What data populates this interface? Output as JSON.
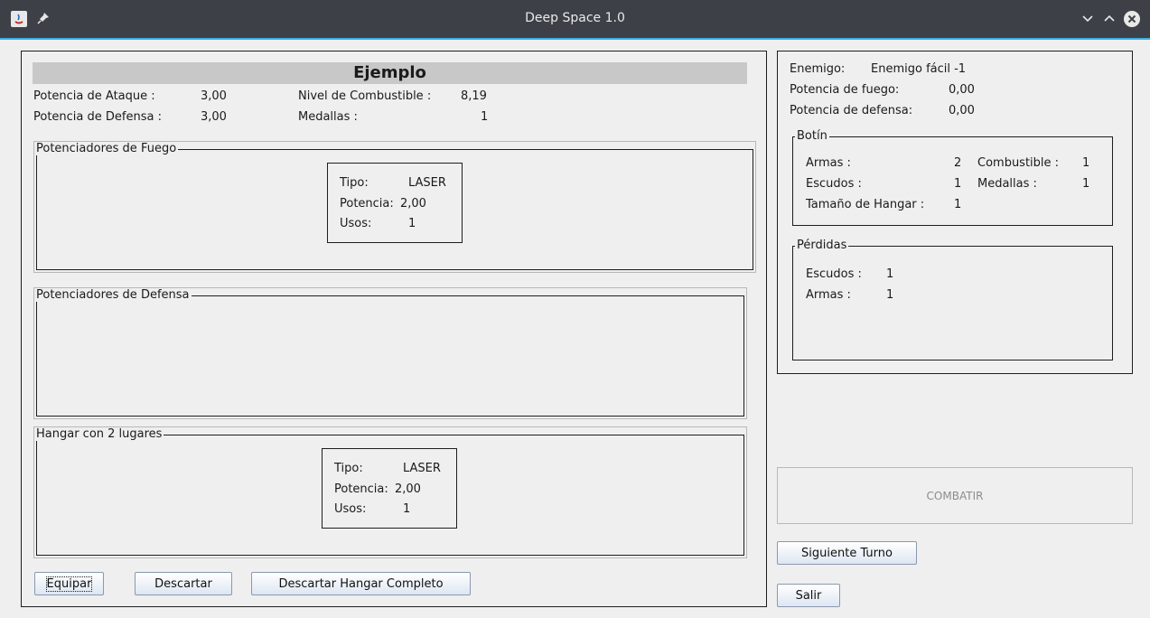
{
  "window": {
    "title": "Deep Space 1.0"
  },
  "station": {
    "name": "Ejemplo",
    "attack_label": "Potencia de Ataque :",
    "attack_value": "3,00",
    "defense_label": "Potencia de Defensa :",
    "defense_value": "3,00",
    "fuel_label": "Nivel de Combustible :",
    "fuel_value": "8,19",
    "medals_label": "Medallas :",
    "medals_value": "1"
  },
  "fire_boosters": {
    "title": "Potenciadores de Fuego",
    "items": [
      {
        "type_label": "Tipo:",
        "type_value": "LASER",
        "power_label": "Potencia:",
        "power_value": "2,00",
        "uses_label": "Usos:",
        "uses_value": "1"
      }
    ]
  },
  "defense_boosters": {
    "title": "Potenciadores de Defensa"
  },
  "hangar": {
    "title": "Hangar con 2 lugares",
    "items": [
      {
        "type_label": "Tipo:",
        "type_value": "LASER",
        "power_label": "Potencia:",
        "power_value": "2,00",
        "uses_label": "Usos:",
        "uses_value": "1"
      }
    ]
  },
  "buttons": {
    "equip": "Equipar",
    "discard": "Descartar",
    "discard_hangar": "Descartar Hangar Completo",
    "combat": "COMBATIR",
    "next_turn": "Siguiente Turno",
    "exit": "Salir"
  },
  "enemy": {
    "enemy_label": "Enemigo:",
    "enemy_name": "Enemigo fácil -1",
    "fire_label": "Potencia de fuego:",
    "fire_value": "0,00",
    "defense_label": "Potencia de defensa:",
    "defense_value": "0,00",
    "loot": {
      "title": "Botín",
      "weapons_label": "Armas :",
      "weapons_value": "2",
      "fuel_label": "Combustible :",
      "fuel_value": "1",
      "shields_label": "Escudos :",
      "shields_value": "1",
      "medals_label": "Medallas :",
      "medals_value": "1",
      "hangar_label": "Tamaño de Hangar :",
      "hangar_value": "1"
    },
    "losses": {
      "title": "Pérdidas",
      "shields_label": "Escudos :",
      "shields_value": "1",
      "weapons_label": "Armas :",
      "weapons_value": "1"
    }
  }
}
